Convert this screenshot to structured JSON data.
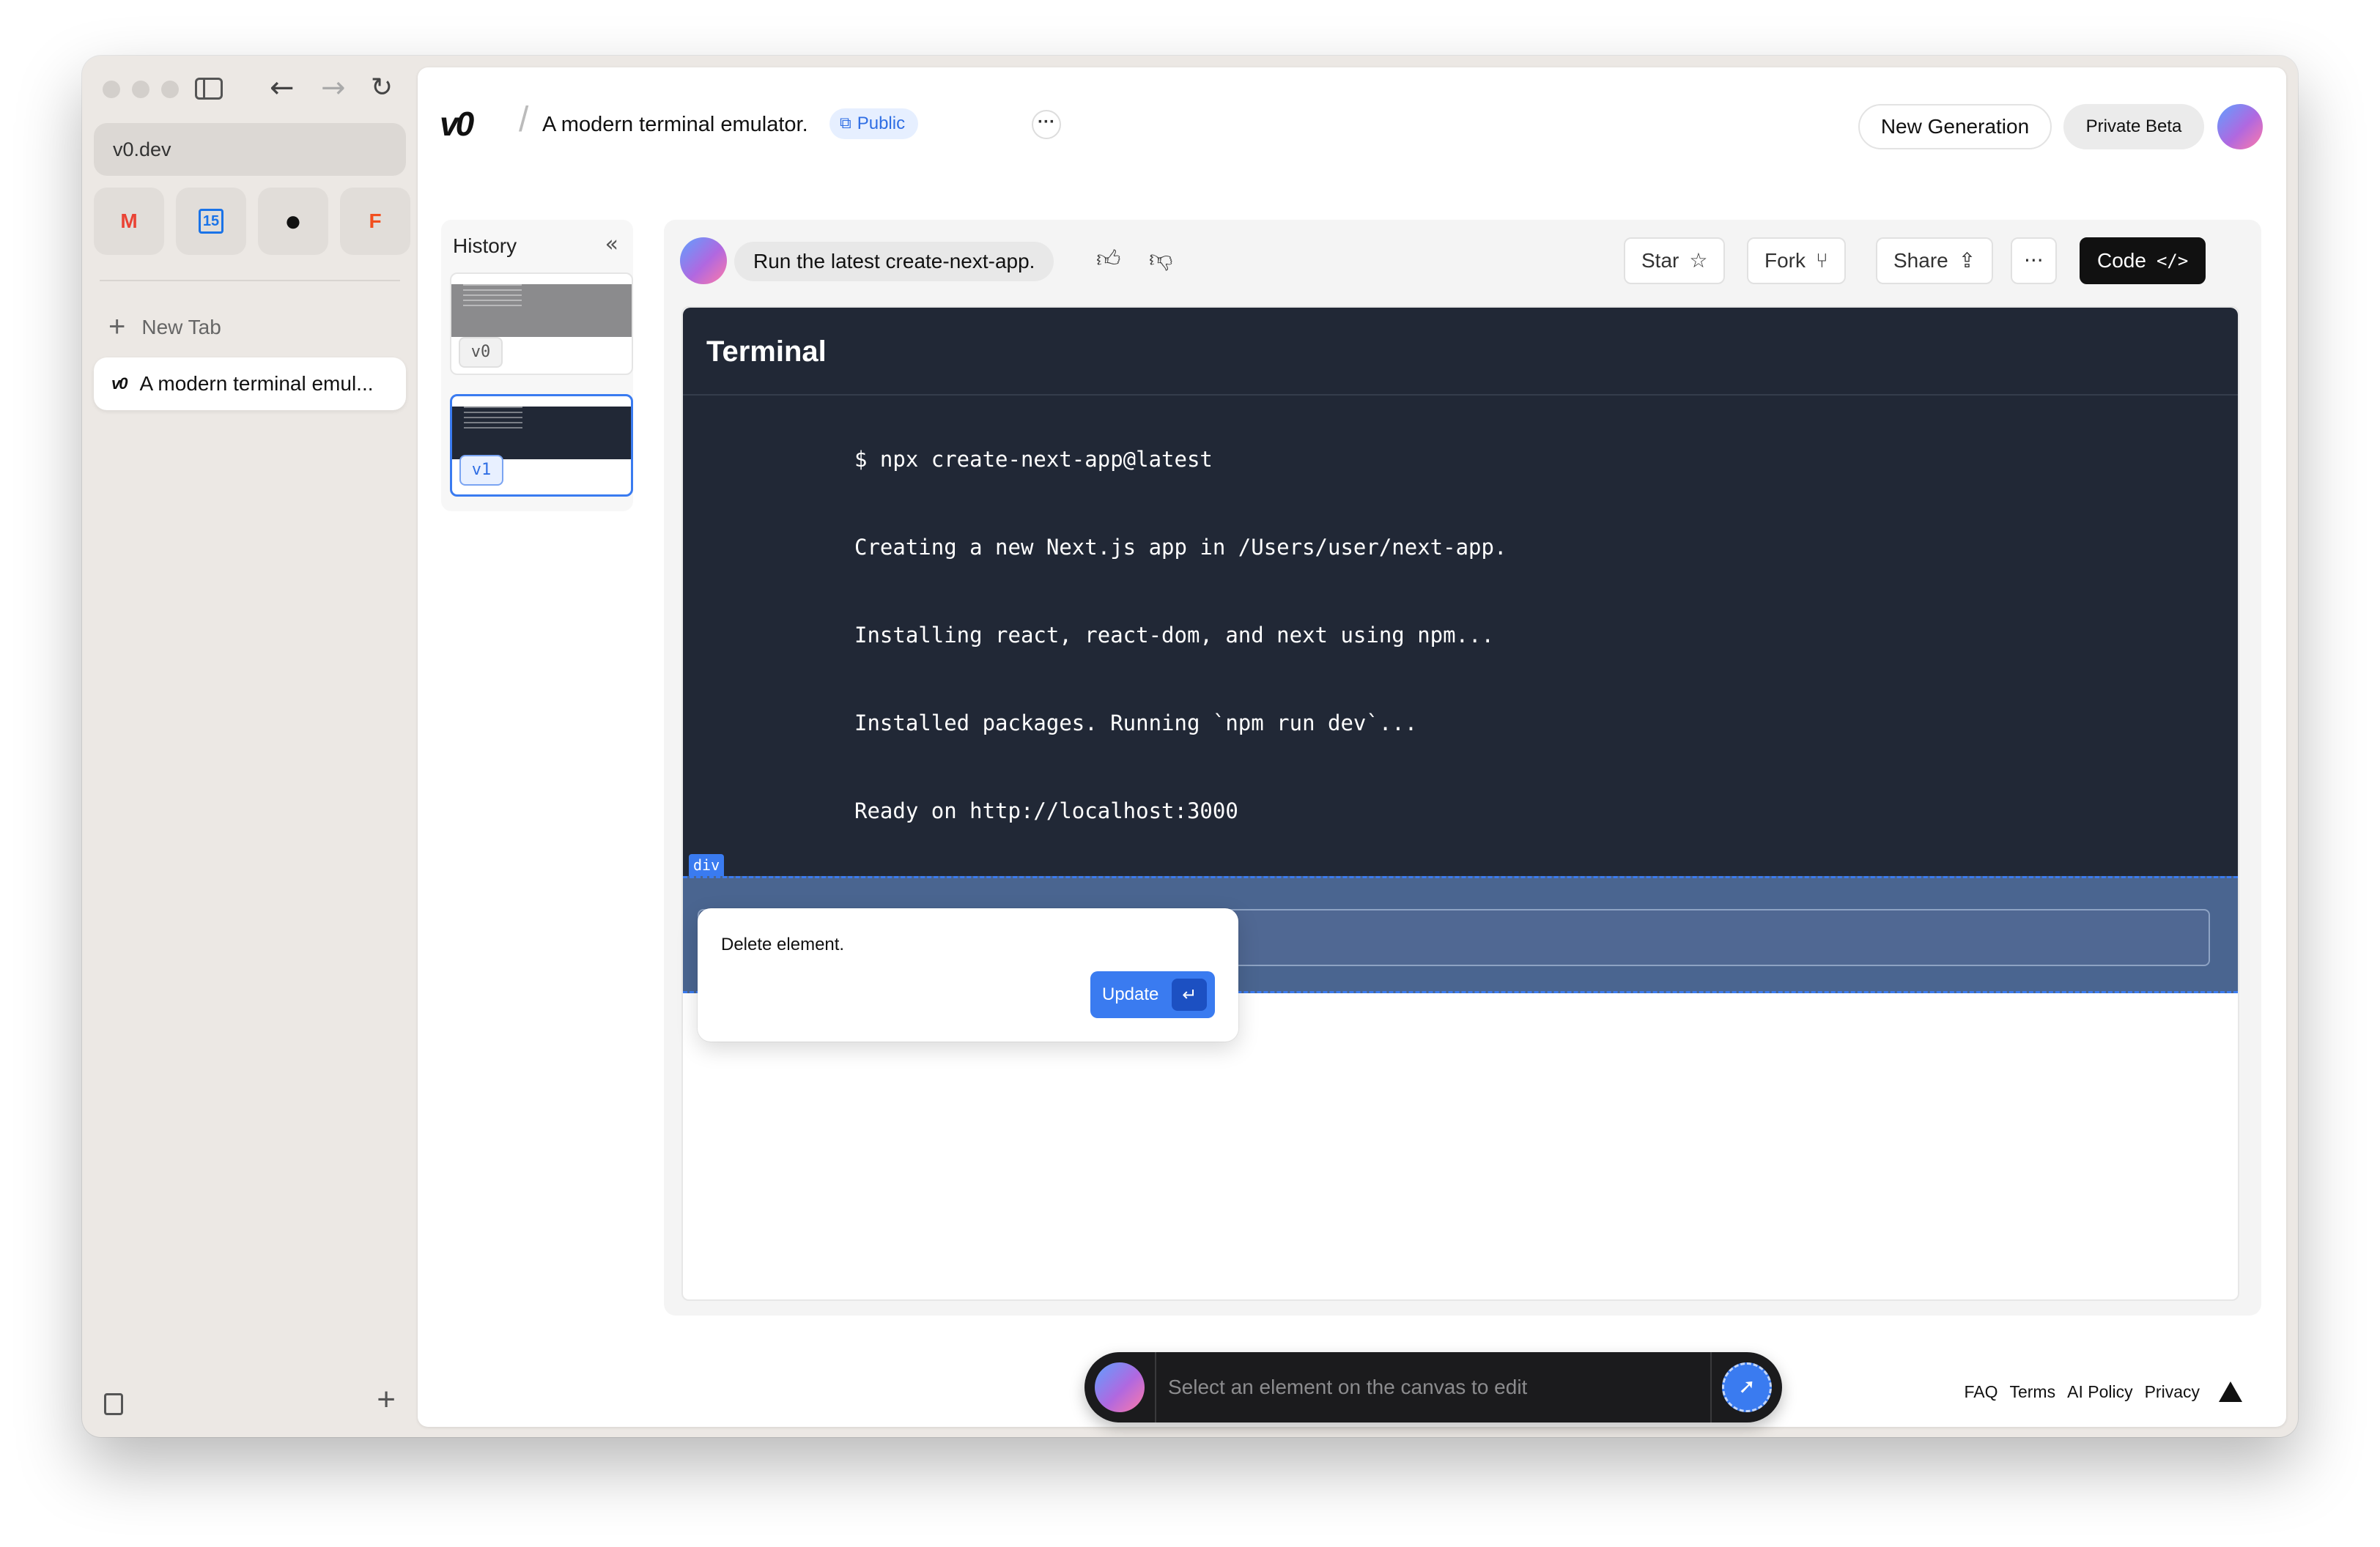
{
  "browser": {
    "url": "v0.dev",
    "new_tab_label": "New Tab",
    "active_tab_title": "A modern terminal emul...",
    "favorites": [
      {
        "name": "gmail-icon",
        "glyph": "M",
        "color": "#ea4335"
      },
      {
        "name": "calendar-icon",
        "glyph": "15",
        "color": "#1a73e8"
      },
      {
        "name": "github-icon",
        "glyph": "●",
        "color": "#111111"
      },
      {
        "name": "figma-icon",
        "glyph": "F",
        "color": "#f24e1e"
      }
    ]
  },
  "header": {
    "logo": "v0",
    "project_title": "A modern terminal emulator.",
    "visibility": "Public",
    "more": "···",
    "new_generation": "New Generation",
    "private_beta": "Private Beta"
  },
  "history": {
    "title": "History",
    "versions": [
      "v0",
      "v1"
    ]
  },
  "prompt": {
    "text": "Run the latest create-next-app."
  },
  "actions": {
    "star": "Star",
    "fork": "Fork",
    "share": "Share",
    "more": "···",
    "code": "Code"
  },
  "terminal": {
    "title": "Terminal",
    "lines": [
      "$ npx create-next-app@latest",
      "Creating a new Next.js app in /Users/user/next-app.",
      "Installing react, react-dom, and next using npm...",
      "Installed packages. Running `npm run dev`...",
      "Ready on http://localhost:3000"
    ]
  },
  "selection": {
    "tag": "div",
    "instruction": "Delete element.",
    "update_label": "Update"
  },
  "edit_bar": {
    "placeholder": "Select an element on the canvas to edit"
  },
  "footer": {
    "links": [
      "FAQ",
      "Terms",
      "AI Policy",
      "Privacy"
    ]
  },
  "colors": {
    "accent": "#3a7bf0",
    "terminal_bg": "#212836",
    "selected_bg": "#4a6590"
  }
}
